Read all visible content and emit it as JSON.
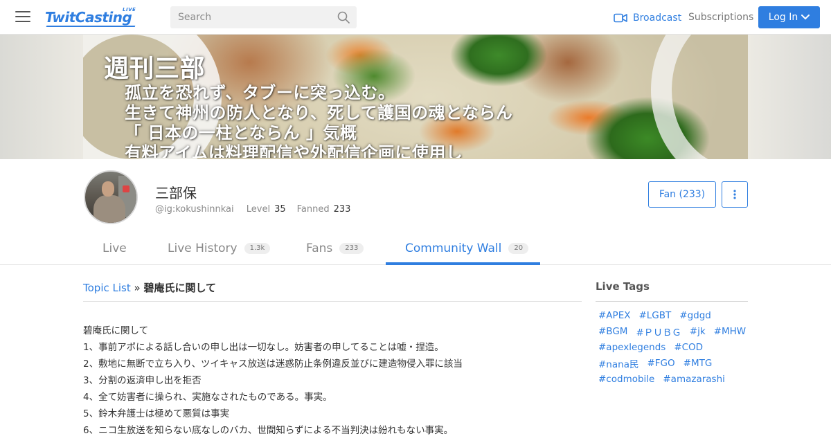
{
  "header": {
    "logo_text": "TwitCasting",
    "logo_live": "LIVE",
    "search_placeholder": "Search",
    "broadcast_label": "Broadcast",
    "subscriptions_label": "Subscriptions",
    "login_label": "Log In",
    "accent_color": "#2f7ee0"
  },
  "banner": {
    "title": "週刊三部",
    "lines": [
      "孤立を恐れず、タブーに突っ込む。",
      "生きて神州の防人となり、死して護国の魂とならん",
      "「 日本の一柱とならん 」気概",
      "有料アイムは料理配信や外配信企画に使用し"
    ]
  },
  "profile": {
    "name": "三部保",
    "handle": "@ig:kokushinnkai",
    "level_label": "Level",
    "level_value": "35",
    "fanned_label": "Fanned",
    "fanned_value": "233",
    "fan_button": "Fan (233)",
    "more_icon": "vertical-ellipsis-icon"
  },
  "tabs": [
    {
      "label": "Live",
      "badge": ""
    },
    {
      "label": "Live History",
      "badge": "1.3k"
    },
    {
      "label": "Fans",
      "badge": "233"
    },
    {
      "label": "Community Wall",
      "badge": "20",
      "active": true
    }
  ],
  "breadcrumb": {
    "link": "Topic List",
    "separator": "»",
    "current": "碧庵氏に関して"
  },
  "post": {
    "lines": [
      "碧庵氏に関して",
      "1、事前アポによる話し合いの申し出は一切なし。妨害者の申してることは嘘・捏造。",
      "2、敷地に無断で立ち入り、ツイキャス放送は迷惑防止条例違反並びに建造物侵入罪に該当",
      "3、分割の返済申し出を拒否",
      "4、全て妨害者に操られ、実施なされたものである。事実。",
      "5、鈴木弁護士は極めて悪質は事実",
      "6、ニコ生放送を知らない底なしのバカ、世間知らずによる不当判決は紛れもない事実。"
    ]
  },
  "sidebar": {
    "title": "Live Tags",
    "tag_rows": [
      [
        "#APEX",
        "#LGBT",
        "#gdgd"
      ],
      [
        "#BGM",
        "#ＰＵＢＧ",
        "#jk",
        "#MHW"
      ],
      [
        "#apexlegends",
        "#COD"
      ],
      [
        "#nana民",
        "#FGO",
        "#MTG"
      ],
      [
        "#codmobile",
        "#amazarashi"
      ]
    ]
  }
}
